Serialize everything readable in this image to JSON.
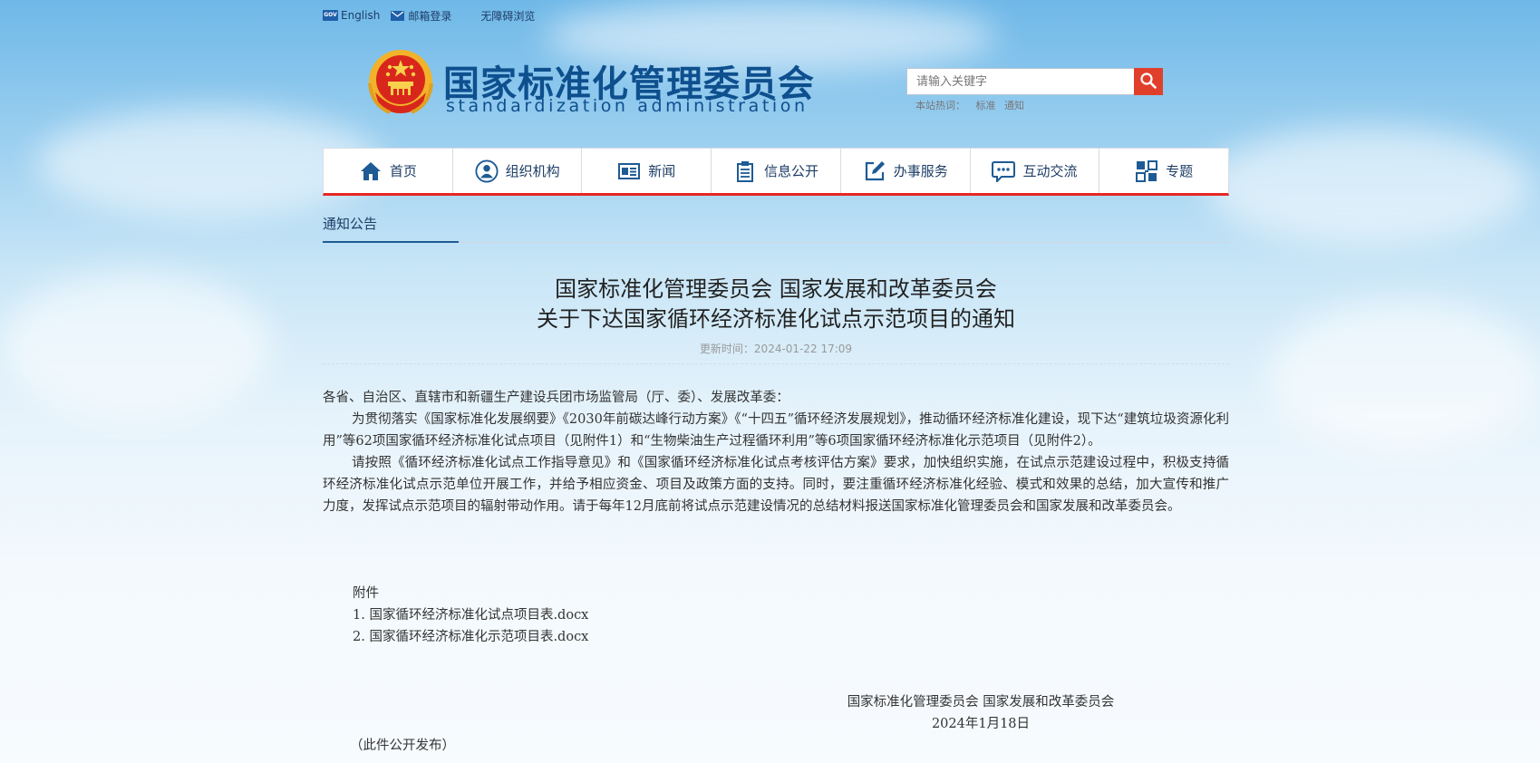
{
  "topbar": {
    "english_icon_text": "GOV",
    "english": "English",
    "mail": "邮箱登录",
    "accessible": "无障碍浏览"
  },
  "header": {
    "logo_cn": "国家标准化管理委员会",
    "logo_en": "standardization administration",
    "search_placeholder": "请输入关键字",
    "hot_label": "本站热词：",
    "hot_words": [
      "标准",
      "通知"
    ]
  },
  "nav": {
    "items": [
      {
        "label": "首页",
        "icon": "home-icon"
      },
      {
        "label": "组织机构",
        "icon": "user-icon"
      },
      {
        "label": "新闻",
        "icon": "newspaper-icon"
      },
      {
        "label": "信息公开",
        "icon": "clipboard-icon"
      },
      {
        "label": "办事服务",
        "icon": "edit-icon"
      },
      {
        "label": "互动交流",
        "icon": "chat-icon"
      },
      {
        "label": "专题",
        "icon": "puzzle-icon"
      }
    ]
  },
  "breadcrumb": {
    "current": "通知公告"
  },
  "article": {
    "title_line1": "国家标准化管理委员会 国家发展和改革委员会",
    "title_line2": "关于下达国家循环经济标准化试点示范项目的通知",
    "updated": "更新时间：2024-01-22 17:09",
    "salutation": "各省、自治区、直辖市和新疆生产建设兵团市场监管局（厅、委）、发展改革委：",
    "para1": "为贯彻落实《国家标准化发展纲要》《2030年前碳达峰行动方案》《“十四五”循环经济发展规划》，推动循环经济标准化建设，现下达“建筑垃圾资源化利用”等62项国家循环经济标准化试点项目（见附件1）和“生物柴油生产过程循环利用”等6项国家循环经济标准化示范项目（见附件2）。",
    "para2": "请按照《循环经济标准化试点工作指导意见》和《国家循环经济标准化试点考核评估方案》要求，加快组织实施，在试点示范建设过程中，积极支持循环经济标准化试点示范单位开展工作，并给予相应资金、项目及政策方面的支持。同时，要注重循环经济标准化经验、模式和效果的总结，加大宣传和推广力度，发挥试点示范项目的辐射带动作用。请于每年12月底前将试点示范建设情况的总结材料报送国家标准化管理委员会和国家发展和改革委员会。",
    "attach_label": "附件",
    "attachments": [
      "1. 国家循环经济标准化试点项目表.docx",
      "2. 国家循环经济标准化示范项目表.docx"
    ],
    "signature": "国家标准化管理委员会 国家发展和改革委员会",
    "date": "2024年1月18日",
    "note": "（此件公开发布）"
  },
  "colors": {
    "nav_accent": "#e62625",
    "brand_blue": "#0e4f8e",
    "search_button": "#e0402b"
  }
}
